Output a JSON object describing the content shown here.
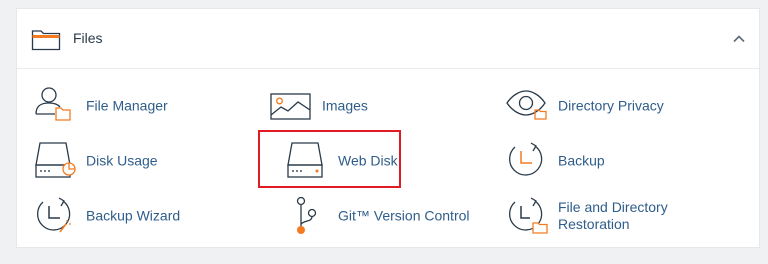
{
  "section": {
    "title": "Files",
    "items": [
      {
        "label": "File Manager",
        "icon": "file-manager-icon"
      },
      {
        "label": "Images",
        "icon": "images-icon"
      },
      {
        "label": "Directory Privacy",
        "icon": "directory-privacy-icon"
      },
      {
        "label": "Disk Usage",
        "icon": "disk-usage-icon"
      },
      {
        "label": "Web Disk",
        "icon": "web-disk-icon"
      },
      {
        "label": "Backup",
        "icon": "backup-icon"
      },
      {
        "label": "Backup Wizard",
        "icon": "backup-wizard-icon"
      },
      {
        "label": "Git™ Version Control",
        "icon": "git-version-control-icon"
      },
      {
        "label": "File and Directory Restoration",
        "icon": "file-restoration-icon"
      }
    ]
  },
  "colors": {
    "accent": "#f47b20",
    "link": "#2f5d8a",
    "icon_stroke": "#293a4a",
    "highlight": "#e11b24"
  }
}
